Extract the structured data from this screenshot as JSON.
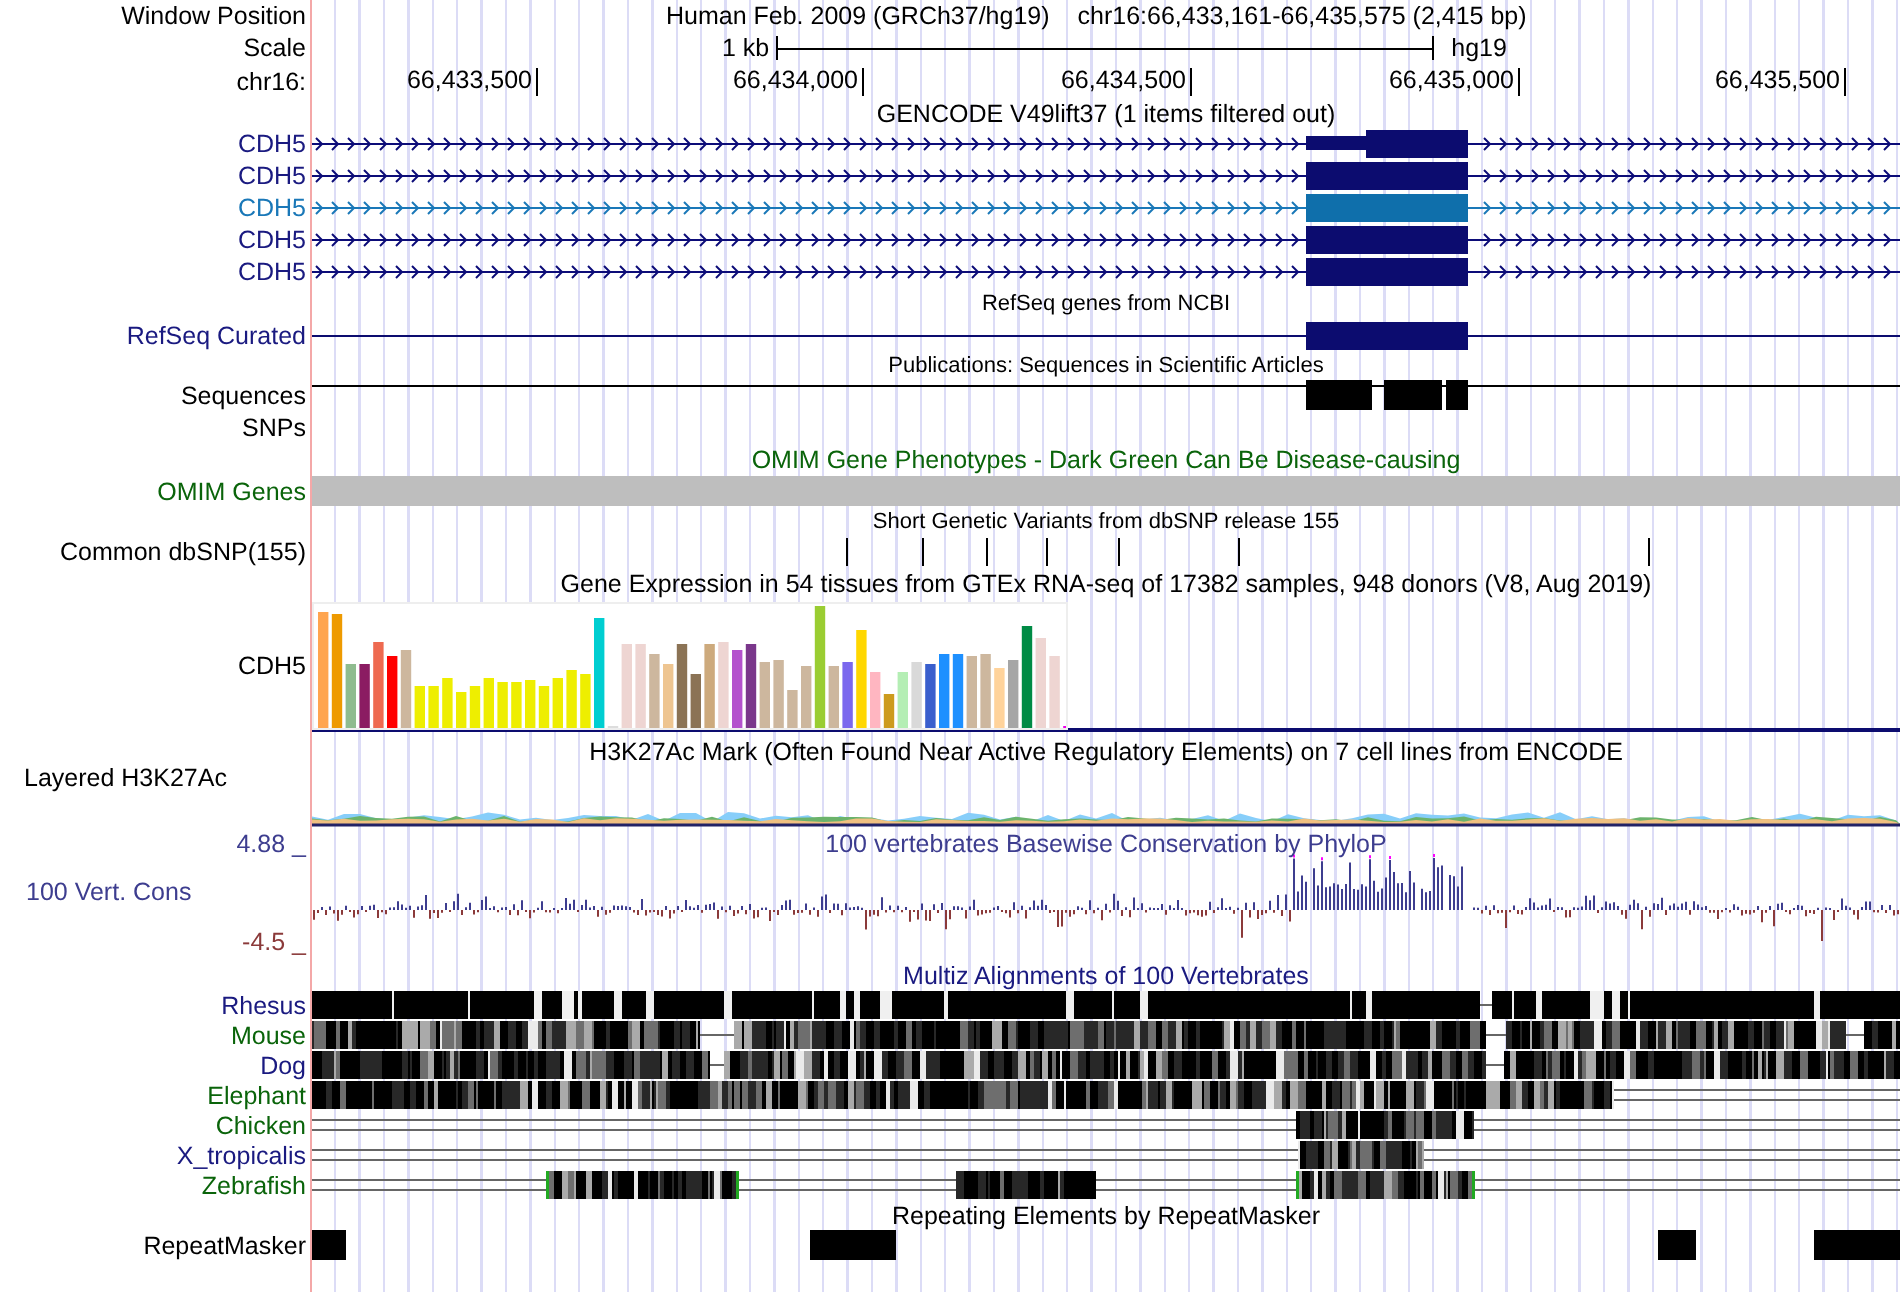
{
  "header": {
    "position_label": "Window Position",
    "assembly_title": "Human Feb. 2009 (GRCh37/hg19)",
    "position": "chr16:66,433,161-66,435,575 (2,415 bp)",
    "scale_label": "Scale",
    "scale_text": "1 kb",
    "assembly": "hg19",
    "chrom_label": "chr16:",
    "ticks": [
      "66,433,500",
      "66,434,000",
      "66,434,500",
      "66,435,000",
      "66,435,500"
    ]
  },
  "gencode": {
    "title": "GENCODE V49lift37 (1 items filtered out)",
    "transcripts": [
      {
        "name": "CDH5",
        "selected": false
      },
      {
        "name": "CDH5",
        "selected": false
      },
      {
        "name": "CDH5",
        "selected": true
      },
      {
        "name": "CDH5",
        "selected": false
      },
      {
        "name": "CDH5",
        "selected": false
      }
    ]
  },
  "refseq": {
    "title": "RefSeq genes from NCBI",
    "label": "RefSeq Curated"
  },
  "publications": {
    "title": "Publications: Sequences in Scientific Articles",
    "label": "Sequences"
  },
  "snps": {
    "label": "SNPs"
  },
  "omim": {
    "title": "OMIM Gene Phenotypes - Dark Green Can Be Disease-causing",
    "label": "OMIM Genes"
  },
  "dbsnp": {
    "title": "Short Genetic Variants from dbSNP release 155",
    "label": "Common dbSNP(155)"
  },
  "gtex": {
    "title": "Gene Expression in 54 tissues from GTEx RNA-seq of 17382 samples, 948 donors (V8, Aug 2019)",
    "label": "CDH5"
  },
  "h3k27ac": {
    "title": "H3K27Ac Mark (Often Found Near Active Regulatory Elements) on 7 cell lines from ENCODE",
    "label": "Layered H3K27Ac"
  },
  "conservation": {
    "title": "100 vertebrates Basewise Conservation by PhyloP",
    "label": "100 Vert. Cons",
    "max": "4.88 _",
    "min": "-4.5 _"
  },
  "multiz": {
    "title": "Multiz Alignments of 100 Vertebrates",
    "species": [
      {
        "name": "Rhesus",
        "color": "#1a1a80"
      },
      {
        "name": "Mouse",
        "color": "#0a640a"
      },
      {
        "name": "Dog",
        "color": "#1a1a80"
      },
      {
        "name": "Elephant",
        "color": "#0a640a"
      },
      {
        "name": "Chicken",
        "color": "#0a640a"
      },
      {
        "name": "X_tropicalis",
        "color": "#1a1a80"
      },
      {
        "name": "Zebrafish",
        "color": "#0a640a"
      }
    ]
  },
  "repeatmasker": {
    "title": "Repeating Elements by RepeatMasker",
    "label": "RepeatMasker"
  }
}
